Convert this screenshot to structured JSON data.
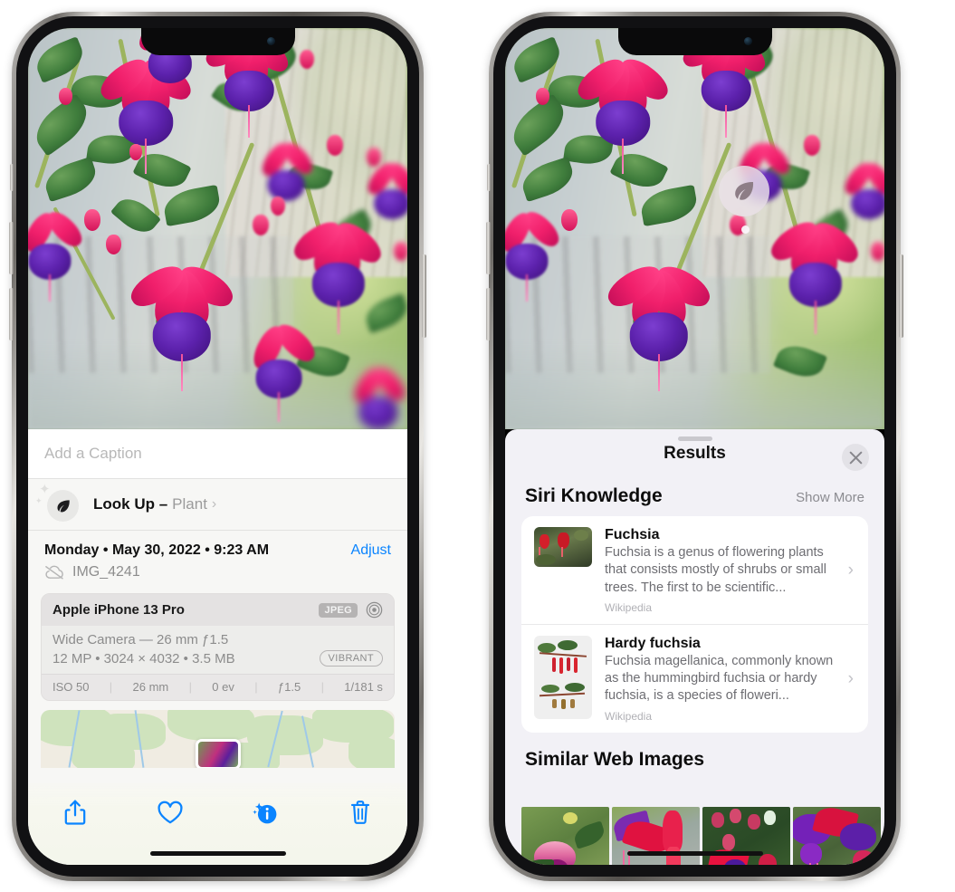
{
  "left_phone": {
    "caption_field": {
      "placeholder": "Add a Caption",
      "value": ""
    },
    "lookup_row": {
      "label": "Look Up –",
      "subject": "Plant",
      "icon": "leaf-icon",
      "chevron": "›"
    },
    "metadata": {
      "date": "Monday • May 30, 2022 • 9:23 AM",
      "adjust_label": "Adjust",
      "filename": "IMG_4241",
      "cloud_icon": "icloud-slash-icon"
    },
    "exif": {
      "device": "Apple iPhone 13 Pro",
      "format_badge": "JPEG",
      "aperture_icon": "aperture-icon",
      "lens": "Wide Camera — 26 mm ƒ1.5",
      "specs": "12 MP • 3024 × 4032 • 3.5 MB",
      "style_badge": "VIBRANT",
      "stats": [
        "ISO 50",
        "26 mm",
        "0 ev",
        "ƒ1.5",
        "1/181 s"
      ],
      "divider": "|"
    },
    "toolbar": [
      {
        "name": "share-button",
        "icon": "share-icon"
      },
      {
        "name": "favorite-button",
        "icon": "heart-icon"
      },
      {
        "name": "info-button",
        "icon": "info-sparkle-icon"
      },
      {
        "name": "delete-button",
        "icon": "trash-icon"
      }
    ]
  },
  "right_phone": {
    "visual_lookup_badge": {
      "icon": "leaf-icon"
    },
    "sheet": {
      "title": "Results",
      "close_icon": "close-icon",
      "grabber": "grabber-handle"
    },
    "siri_knowledge": {
      "section_title": "Siri Knowledge",
      "action_label": "Show More",
      "cards": [
        {
          "title": "Fuchsia",
          "description": "Fuchsia is a genus of flowering plants that consists mostly of shrubs or small trees. The first to be scientific...",
          "source": "Wikipedia",
          "chevron": "›"
        },
        {
          "title": "Hardy fuchsia",
          "description": "Fuchsia magellanica, commonly known as the hummingbird fuchsia or hardy fuchsia, is a species of floweri...",
          "source": "Wikipedia",
          "chevron": "›"
        }
      ]
    },
    "similar_web_images": {
      "section_title": "Similar Web Images",
      "thumbnails": [
        "pink-white-fuchsia-on-green-leaves",
        "red-fuchsia-closeup-on-gray",
        "fuchsia-shrub-with-buds",
        "purple-magenta-fuchsia-cluster"
      ]
    }
  },
  "colors": {
    "accent_blue": "#0a84ff",
    "sheet_bg": "#f2f1f6",
    "panel_bg": "#f7f7f5",
    "card_bg": "#ffffff",
    "secondary_text": "#8b8b90"
  }
}
